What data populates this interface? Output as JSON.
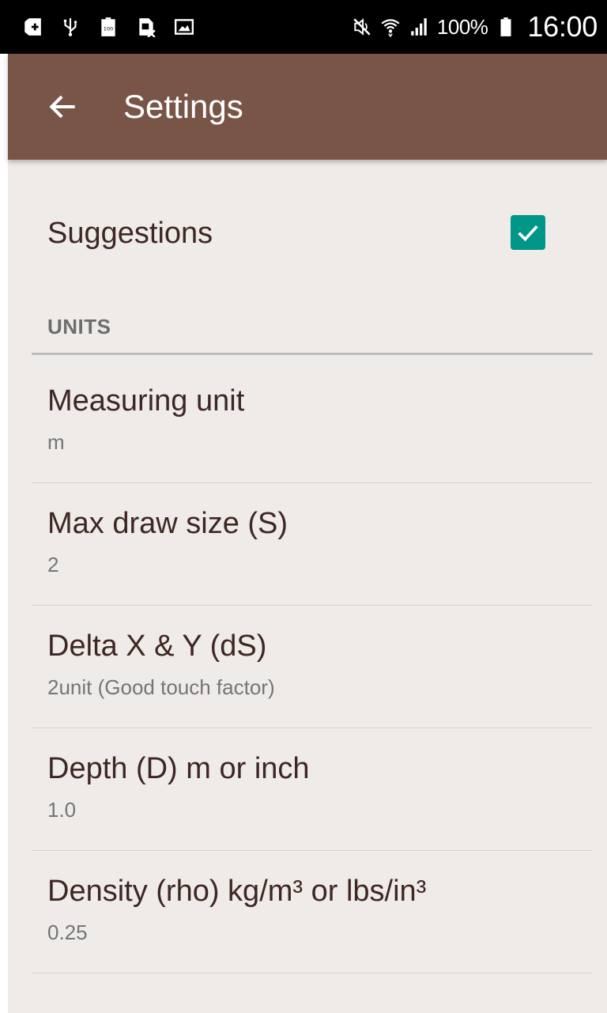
{
  "status_bar": {
    "battery_percent": "100%",
    "time": "16:00",
    "icons": [
      "add-notification-icon",
      "usb-icon",
      "battery-100-icon",
      "sim-error-icon",
      "image-icon",
      "mute-icon",
      "wifi-icon",
      "signal-icon",
      "battery-icon"
    ]
  },
  "app_bar": {
    "title": "Settings",
    "back_icon": "arrow-back-icon",
    "color": "#795548"
  },
  "suggestions": {
    "label": "Suggestions",
    "checked": true,
    "accent": "#009688"
  },
  "units_category": {
    "label": "UNITS"
  },
  "preferences": [
    {
      "title": "Measuring unit",
      "summary": "m"
    },
    {
      "title": "Max draw size (S)",
      "summary": "2"
    },
    {
      "title": "Delta X & Y (dS)",
      "summary": "2unit (Good touch factor)"
    },
    {
      "title": "Depth (D) m or inch",
      "summary": "1.0"
    },
    {
      "title": "Density (rho) kg/m³ or lbs/in³",
      "summary": "0.25"
    }
  ]
}
